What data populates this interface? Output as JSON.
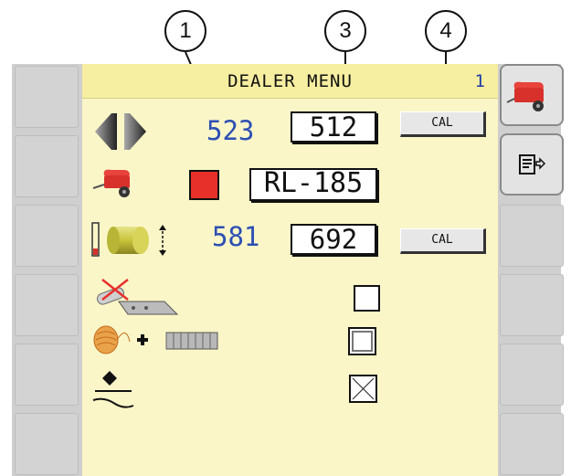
{
  "callouts": [
    "1",
    "3",
    "4"
  ],
  "header": {
    "title": "DEALER MENU",
    "page": "1"
  },
  "rows": {
    "arrows": {
      "icon": "left-right-arrows-icon",
      "actual": "523",
      "setting": "512",
      "cal": "CAL"
    },
    "baler": {
      "icon": "baler-icon",
      "status_color": "#e8302a",
      "model": "RL-185"
    },
    "bale": {
      "icon": "bale-diameter-icon",
      "actual": "581",
      "setting": "692",
      "cal": "CAL"
    },
    "pickup": {
      "icon": "pickup-disabled-icon",
      "checked": false
    },
    "twine_net": {
      "icon": "twine-plus-net-icon",
      "checked": false
    },
    "ground": {
      "icon": "ground-position-icon",
      "checked": true
    }
  },
  "side_keys": {
    "top_right": "baler-icon",
    "second_right": "document-arrow-icon"
  },
  "colors": {
    "screen": "#faf6c8",
    "titlebar": "#f6eea0",
    "values": "#2c4fb3",
    "frame": "#cfcfcf"
  }
}
